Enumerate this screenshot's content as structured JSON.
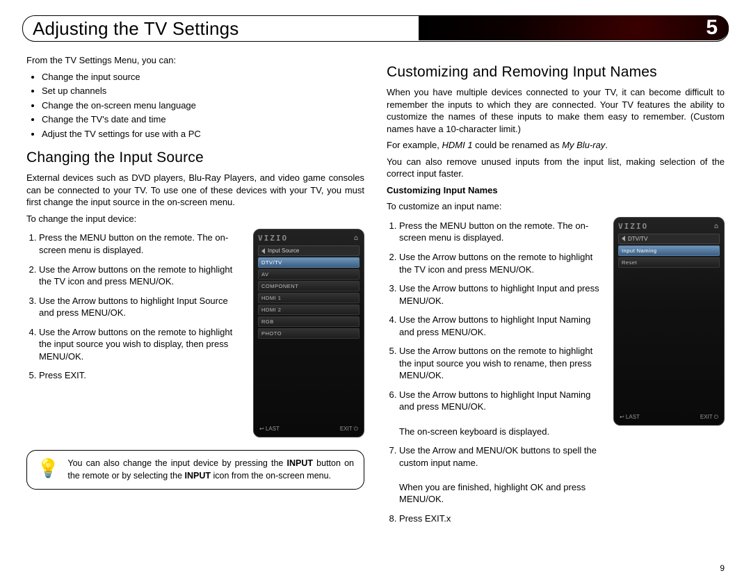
{
  "page_number": "9",
  "chapter_number": "5",
  "title": "Adjusting the TV Settings",
  "left": {
    "intro": "From the TV Settings Menu, you can:",
    "bullets": [
      "Change the input source",
      "Set up channels",
      "Change the on-screen menu language",
      "Change the TV's date and time",
      "Adjust the TV settings for use with a PC"
    ],
    "h2": "Changing the Input Source",
    "p1": "External devices such as DVD players, Blu-Ray Players, and video game consoles can be connected to your TV. To use one of these devices with your TV, you must first change the input source in the on-screen menu.",
    "p2": "To change the input device:",
    "steps": [
      "Press the MENU button on the remote. The on-screen menu is displayed.",
      "Use the Arrow buttons on the remote to highlight the TV icon and press MENU/OK.",
      "Use the Arrow buttons to highlight Input Source and press MENU/OK.",
      "Use the Arrow buttons on the remote to highlight the input source you wish to display, then press MENU/OK.",
      "Press EXIT."
    ],
    "tip_pre": "You can also change the input device by pressing the ",
    "tip_b1": "INPUT",
    "tip_mid": " button on the remote or by selecting the ",
    "tip_b2": "INPUT",
    "tip_post": " icon from the on-screen menu.",
    "tv": {
      "logo": "VIZIO",
      "header": "Input Source",
      "rows": [
        "DTV/TV",
        "AV",
        "COMPONENT",
        "HDMI 1",
        "HDMI 2",
        "RGB",
        "PHOTO"
      ],
      "sel": 0,
      "foot_left": "↩ LAST",
      "foot_right": "EXIT ⏻"
    }
  },
  "right": {
    "h2": "Customizing and Removing Input Names",
    "p1": "When you have multiple devices connected to your TV, it can become difficult to remember the inputs to which they are connected. Your TV features the ability to customize the names of these inputs to make them easy to remember. (Custom names have a 10-character limit.)",
    "p2_pre": "For example, ",
    "p2_i1": "HDMI 1",
    "p2_mid": " could be renamed as ",
    "p2_i2": "My Blu-ray",
    "p2_post": ".",
    "p3": "You can also remove unused inputs from the input list, making selection of the correct input faster.",
    "subh": "Customizing Input Names",
    "p4": "To customize an input name:",
    "steps": [
      "Press the MENU button on the remote. The on-screen menu is displayed.",
      "Use the Arrow buttons on the remote to highlight the TV icon and press MENU/OK.",
      "Use the Arrow buttons to highlight Input and press MENU/OK.",
      "Use the Arrow buttons to highlight Input Naming and press MENU/OK.",
      "Use the Arrow buttons on the remote to highlight the input source you wish to rename, then press MENU/OK.",
      "Use the Arrow buttons to highlight Input Naming and press MENU/OK.\n\nThe on-screen keyboard is displayed.",
      "Use the Arrow and MENU/OK buttons to spell the custom input name.\n\nWhen you are finished, highlight OK and press MENU/OK.",
      "Press EXIT.x"
    ],
    "tv": {
      "logo": "VIZIO",
      "header": "DTV/TV",
      "rows": [
        "Input Naming",
        "Reset"
      ],
      "sel": 0,
      "foot_left": "↩ LAST",
      "foot_right": "EXIT ⏻"
    }
  }
}
